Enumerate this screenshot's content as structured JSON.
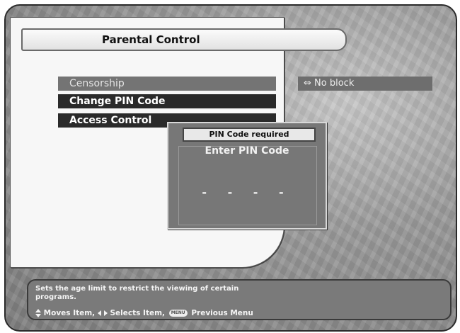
{
  "header": {
    "title": "Parental Control"
  },
  "menu": {
    "items": [
      {
        "label": "Censorship"
      },
      {
        "label": "Change PIN Code"
      },
      {
        "label": "Access Control"
      }
    ]
  },
  "value_display": {
    "arrows": "⇔",
    "text": "No block"
  },
  "dialog": {
    "title": "PIN Code required",
    "prompt": "Enter PIN Code",
    "pin_mask": "- - - -"
  },
  "footer": {
    "help_text": "Sets the age limit to restrict the viewing of certain programs.",
    "hint_move": "Moves Item,",
    "hint_select": "Selects Item,",
    "hint_menu": "Previous Menu",
    "menu_key": "MENU"
  }
}
